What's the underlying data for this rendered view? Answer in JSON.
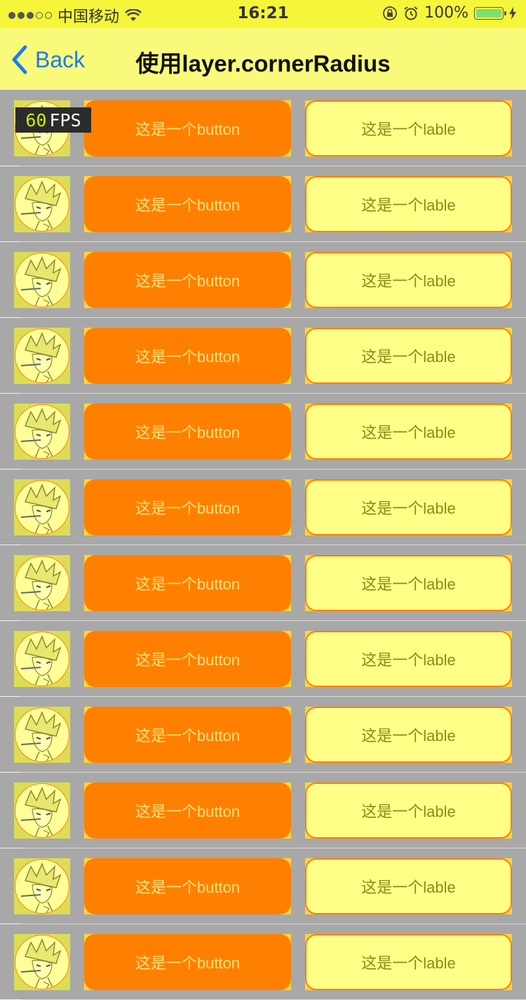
{
  "status_bar": {
    "carrier": "中国移动",
    "time": "16:21",
    "battery": "100%",
    "signal_bars_filled": 3,
    "signal_bars_total": 5,
    "icons": [
      "wifi-icon",
      "orientation-lock-icon",
      "alarm-icon",
      "battery-icon",
      "charging-icon"
    ]
  },
  "nav": {
    "back_label": "Back",
    "title": "使用layer.cornerRadius"
  },
  "rows": [
    {
      "button": "这是一个button",
      "label": "这是一个lable"
    },
    {
      "button": "这是一个button",
      "label": "这是一个lable"
    },
    {
      "button": "这是一个button",
      "label": "这是一个lable"
    },
    {
      "button": "这是一个button",
      "label": "这是一个lable"
    },
    {
      "button": "这是一个button",
      "label": "这是一个lable"
    },
    {
      "button": "这是一个button",
      "label": "这是一个lable"
    },
    {
      "button": "这是一个button",
      "label": "这是一个lable"
    },
    {
      "button": "这是一个button",
      "label": "这是一个lable"
    },
    {
      "button": "这是一个button",
      "label": "这是一个lable"
    },
    {
      "button": "这是一个button",
      "label": "这是一个lable"
    },
    {
      "button": "这是一个button",
      "label": "这是一个lable"
    },
    {
      "button": "这是一个button",
      "label": "这是一个lable"
    }
  ],
  "fps_overlay": {
    "value": "60",
    "unit": "FPS"
  },
  "colors": {
    "status_bar_bg": "#f5f53a",
    "nav_bg": "#fafa7a",
    "list_bg": "#a8a8a8",
    "button_bg": "#ff8000",
    "label_bg": "#ffff88",
    "accent_border": "#ff8000",
    "back_tint": "#1a7cf0"
  }
}
